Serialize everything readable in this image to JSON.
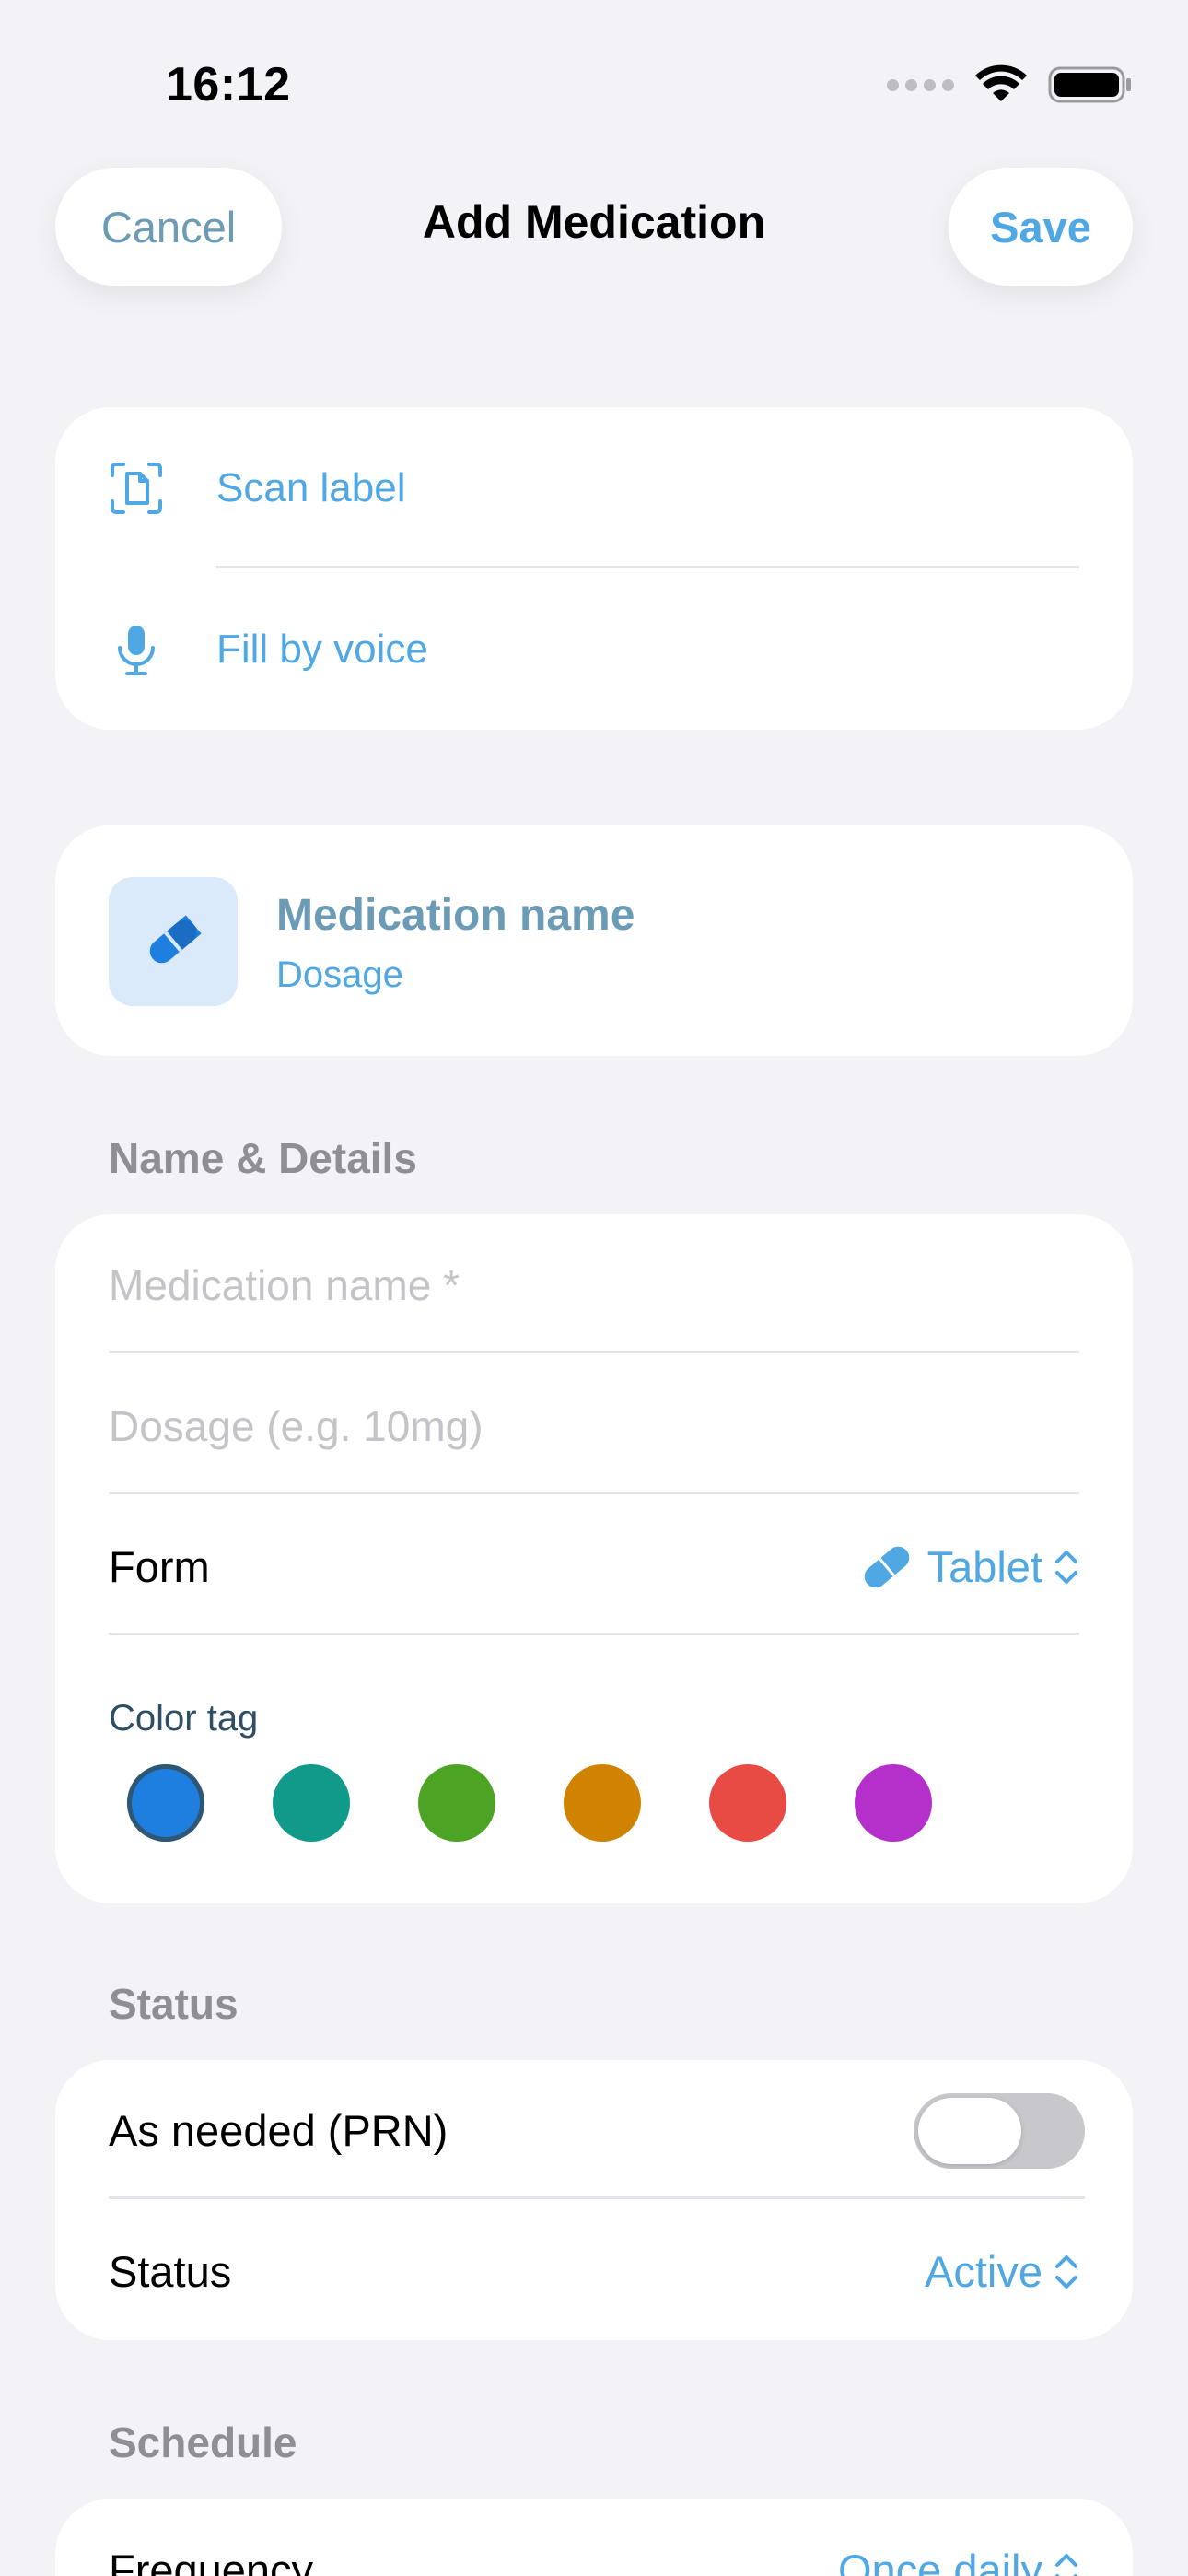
{
  "status_bar": {
    "time": "16:12"
  },
  "nav": {
    "cancel_label": "Cancel",
    "title": "Add Medication",
    "save_label": "Save"
  },
  "quick_actions": [
    {
      "label": "Scan label",
      "icon": "document-scan-icon"
    },
    {
      "label": "Fill by voice",
      "icon": "microphone-icon"
    }
  ],
  "preview": {
    "icon": "pill-icon",
    "name": "Medication name",
    "dosage": "Dosage"
  },
  "name_details": {
    "header": "Name & Details",
    "name_placeholder": "Medication name *",
    "dosage_placeholder": "Dosage (e.g. 10mg)",
    "form_label": "Form",
    "form_value": "Tablet",
    "color_tag_label": "Color tag",
    "colors": [
      "#1f7fe0",
      "#0f9a8a",
      "#4da324",
      "#d08300",
      "#e84a44",
      "#b52fcb"
    ],
    "selected_color_index": 0
  },
  "status_section": {
    "header": "Status",
    "prn_label": "As needed (PRN)",
    "prn_enabled": false,
    "status_label": "Status",
    "status_value": "Active"
  },
  "schedule": {
    "header": "Schedule",
    "frequency_label": "Frequency",
    "frequency_value": "Once daily"
  },
  "colors": {
    "accent": "#4fa7e3",
    "muted_accent": "#6b9bb5",
    "background": "#f2f2f7"
  }
}
